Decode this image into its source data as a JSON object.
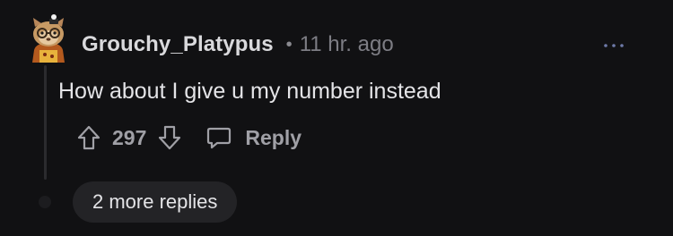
{
  "comment": {
    "author": "Grouchy_Platypus",
    "separator": "•",
    "timestamp": "11 hr. ago",
    "body": "How about I give u my number instead",
    "score": "297",
    "reply_label": "Reply",
    "more_replies_label": "2 more replies"
  },
  "icons": {
    "avatar": "snoo-avatar-icon",
    "more": "more-options-icon",
    "upvote": "upvote-arrow-icon",
    "downvote": "downvote-arrow-icon",
    "reply": "speech-bubble-icon"
  },
  "colors": {
    "background": "#111113",
    "text_primary": "#e4e4e7",
    "text_muted": "#a0a0a6",
    "pill_background": "#232326"
  }
}
